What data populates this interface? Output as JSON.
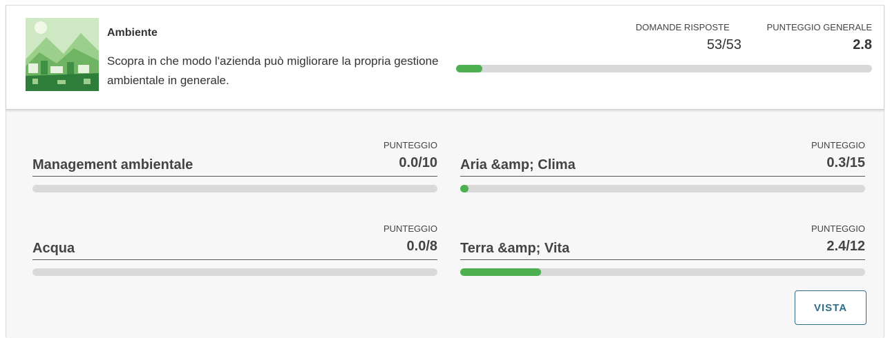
{
  "module": {
    "title": "Ambiente",
    "description": "Scopra in che modo l'azienda può migliorare la propria gestione ambientale in generale.",
    "thumbnail_icon": "environment-landscape-image",
    "answered_label": "DOMANDE RISPOSTE",
    "answered_value": "53/53",
    "score_label": "PUNTEGGIO GENERALE",
    "score_value": "2.8",
    "overall_progress": 0.063
  },
  "categories": [
    {
      "name": "Management ambientale",
      "score_label": "PUNTEGGIO",
      "score": "0.0/10",
      "progress": 0.0
    },
    {
      "name": "Aria &amp; Clima",
      "score_label": "PUNTEGGIO",
      "score": "0.3/15",
      "progress": 0.02
    },
    {
      "name": "Acqua",
      "score_label": "PUNTEGGIO",
      "score": "0.0/8",
      "progress": 0.0
    },
    {
      "name": "Terra &amp; Vita",
      "score_label": "PUNTEGGIO",
      "score": "2.4/12",
      "progress": 0.2
    }
  ],
  "actions": {
    "view_label": "VISTA"
  },
  "colors": {
    "progress": "#4caf50",
    "track": "#d9d9d9",
    "button": "#2d6f8a"
  }
}
